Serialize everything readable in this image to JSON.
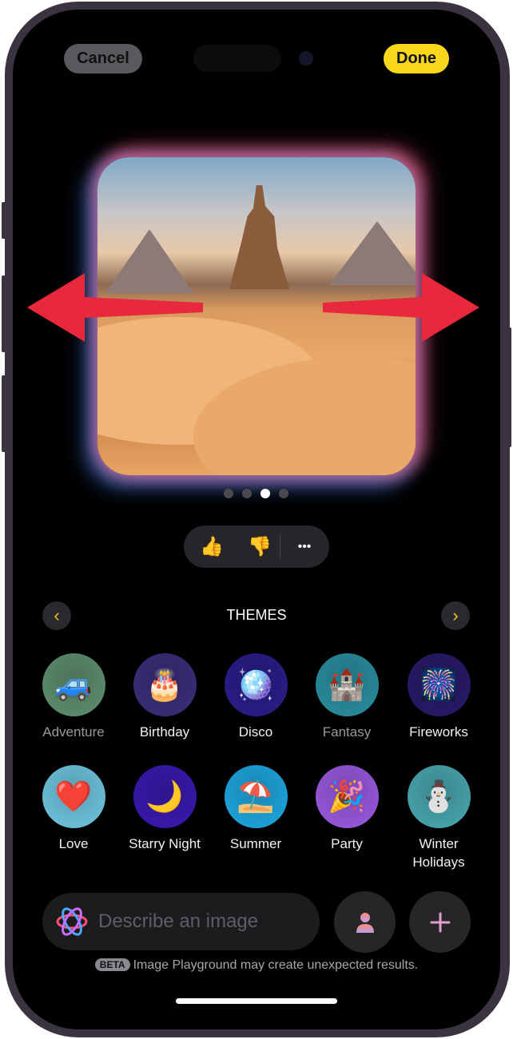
{
  "header": {
    "cancel_label": "Cancel",
    "done_label": "Done"
  },
  "carousel": {
    "pages": 4,
    "active_page": 3
  },
  "feedback": {
    "thumbs_up": "👍",
    "thumbs_down": "👎",
    "more": "•••"
  },
  "themes": {
    "title": "THEMES",
    "prev": "‹",
    "next": "›",
    "items": [
      {
        "label": "Adventure",
        "emoji": "🚙",
        "bg": "#5f8f6f",
        "dim": true
      },
      {
        "label": "Birthday",
        "emoji": "🎂",
        "bg": "#3a2f7a",
        "dim": false
      },
      {
        "label": "Disco",
        "emoji": "🪩",
        "bg": "#2a1e8a",
        "dim": false
      },
      {
        "label": "Fantasy",
        "emoji": "🏰",
        "bg": "#2a8fa0",
        "dim": true
      },
      {
        "label": "Fireworks",
        "emoji": "🎆",
        "bg": "#2a1a6a",
        "dim": false
      },
      {
        "label": "Love",
        "emoji": "❤️",
        "bg": "#6fc7e0",
        "dim": false
      },
      {
        "label": "Starry Night",
        "emoji": "🌙",
        "bg": "#3a1ab0",
        "dim": false
      },
      {
        "label": "Summer",
        "emoji": "⛱️",
        "bg": "#1ea8e0",
        "dim": false
      },
      {
        "label": "Party",
        "emoji": "🎉",
        "bg": "#9a5ae0",
        "dim": false
      },
      {
        "label": "Winter Holidays",
        "emoji": "⛄",
        "bg": "#4aa8b0",
        "dim": false
      }
    ]
  },
  "input": {
    "placeholder": "Describe an image"
  },
  "footer": {
    "beta_badge": "BETA",
    "disclaimer": "Image Playground may create unexpected results."
  },
  "colors": {
    "accent": "#f9d71c",
    "annotation_arrow": "#e8283c"
  }
}
